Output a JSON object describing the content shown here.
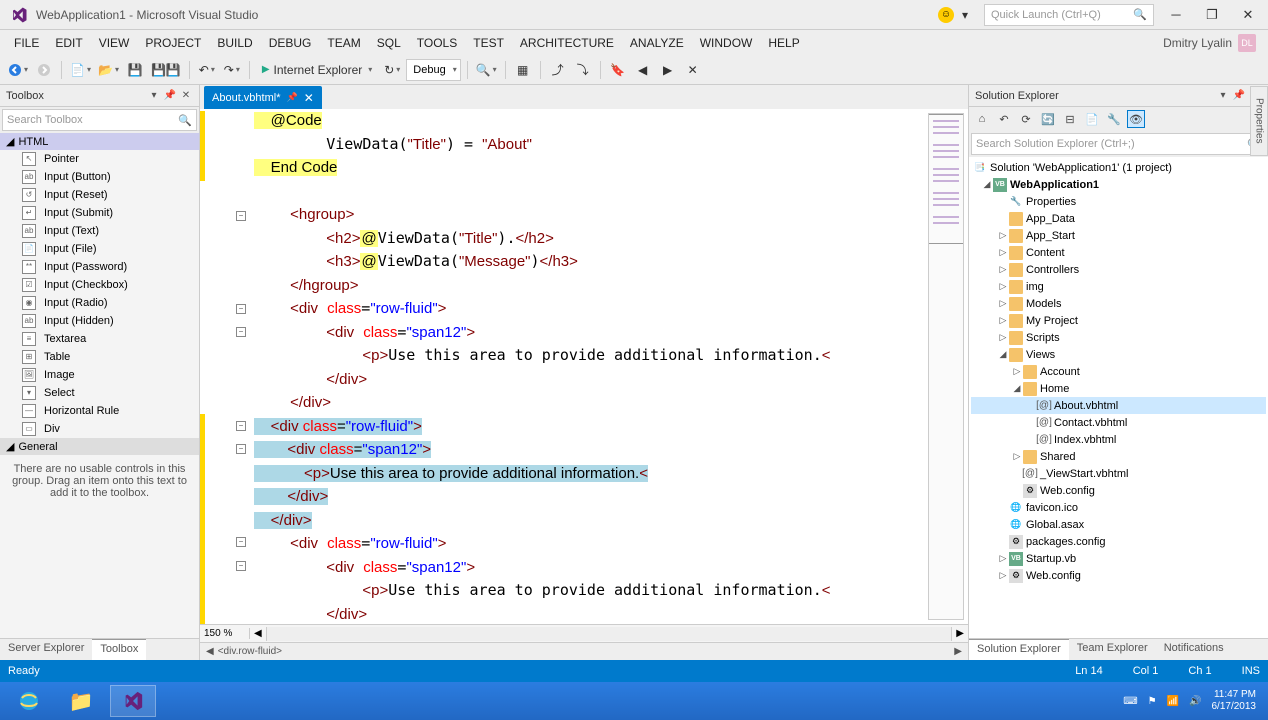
{
  "titlebar": {
    "title": "WebApplication1 - Microsoft Visual Studio",
    "quick_launch_placeholder": "Quick Launch (Ctrl+Q)"
  },
  "menu": {
    "items": [
      "FILE",
      "EDIT",
      "VIEW",
      "PROJECT",
      "BUILD",
      "DEBUG",
      "TEAM",
      "SQL",
      "TOOLS",
      "TEST",
      "ARCHITECTURE",
      "ANALYZE",
      "WINDOW",
      "HELP"
    ],
    "user": "Dmitry Lyalin",
    "user_initials": "DL"
  },
  "toolbar": {
    "run_label": "Internet Explorer",
    "config_label": "Debug"
  },
  "toolbox": {
    "title": "Toolbox",
    "search_placeholder": "Search Toolbox",
    "group_html": "HTML",
    "items": [
      "Pointer",
      "Input (Button)",
      "Input (Reset)",
      "Input (Submit)",
      "Input (Text)",
      "Input (File)",
      "Input (Password)",
      "Input (Checkbox)",
      "Input (Radio)",
      "Input (Hidden)",
      "Textarea",
      "Table",
      "Image",
      "Select",
      "Horizontal Rule",
      "Div"
    ],
    "group_general": "General",
    "empty_msg": "There are no usable controls in this group. Drag an item onto this text to add it to the toolbox.",
    "tabs": {
      "server": "Server Explorer",
      "toolbox": "Toolbox"
    }
  },
  "editor": {
    "tab_name": "About.vbhtml*",
    "zoom": "150 %",
    "breadcrumb": "<div.row-fluid>",
    "lines": {
      "l1": "    @Code",
      "l2": "        ViewData(\"Title\") = \"About\"",
      "l3": "    End Code",
      "l4_open": "<hgroup>",
      "l5_a": "        <h2>",
      "l5_b": "@",
      "l5_c": "ViewData(\"Title\")",
      "l5_d": ".</h2>",
      "l6_a": "        <h3>",
      "l6_b": "@",
      "l6_c": "ViewData(\"Message\")",
      "l6_d": "</h3>",
      "l7": "    </hgroup>",
      "ld_open": "    <div class=\"row-fluid\">",
      "ld_inner_open": "        <div class=\"span12\">",
      "lp": "            <p>Use this area to provide additional information.<",
      "ld_inner_close": "        </div>",
      "ld_close": "    </div>"
    }
  },
  "solution": {
    "title": "Solution Explorer",
    "search_placeholder": "Search Solution Explorer (Ctrl+;)",
    "root": "Solution 'WebApplication1' (1 project)",
    "project": "WebApplication1",
    "nodes": {
      "properties": "Properties",
      "app_data": "App_Data",
      "app_start": "App_Start",
      "content": "Content",
      "controllers": "Controllers",
      "img": "img",
      "models": "Models",
      "my_project": "My Project",
      "scripts": "Scripts",
      "views": "Views",
      "account": "Account",
      "home": "Home",
      "about": "About.vbhtml",
      "contact": "Contact.vbhtml",
      "index": "Index.vbhtml",
      "shared": "Shared",
      "viewstart": "_ViewStart.vbhtml",
      "webconfig_views": "Web.config",
      "favicon": "favicon.ico",
      "global": "Global.asax",
      "packages": "packages.config",
      "startup": "Startup.vb",
      "webconfig": "Web.config"
    },
    "tabs": {
      "solution": "Solution Explorer",
      "team": "Team Explorer",
      "notifications": "Notifications"
    }
  },
  "properties_tab": "Properties",
  "statusbar": {
    "ready": "Ready",
    "ln": "Ln 14",
    "col": "Col 1",
    "ch": "Ch 1",
    "ins": "INS"
  },
  "taskbar": {
    "time": "11:47 PM",
    "date": "6/17/2013"
  }
}
